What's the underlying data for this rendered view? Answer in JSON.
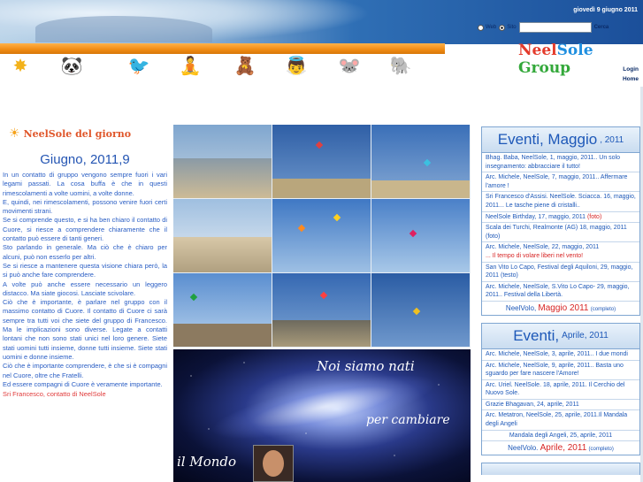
{
  "header": {
    "date": "giovedì 9 giugno 2011",
    "search": {
      "option_web": "Web",
      "option_site": "Sito",
      "selected": "Sito",
      "button_label": "Cerca",
      "placeholder": ""
    }
  },
  "brand": {
    "part1": "Neel",
    "part2": "Sole",
    "part3": " Group"
  },
  "nav": {
    "login": "Login",
    "home": "Home"
  },
  "left": {
    "section_title": "NeelSole del giorno",
    "month_title": "Giugno, 2011,9",
    "paragraphs": [
      "In un contatto di gruppo vengono sempre fuori i vari legami passati. La cosa buffa è che in questi rimescolamenti a volte uomini, a volte donne.",
      "E, quindi, nei rimescolamenti, possono venire fuori certi movimenti strani.",
      "Se si comprende questo, e si ha ben chiaro il contatto di Cuore, si riesce a comprendere chiaramente che il contatto può essere di tanti generi.",
      "Sto parlando in generale. Ma ciò che è chiaro per alcuni, può non esserlo per altri.",
      "Se si riesce a mantenere questa visione chiara però, la si può anche fare comprendere.",
      "A volte può anche essere necessario un leggero distacco. Ma siate giocosi. Lasciate scivolare.",
      "Ciò che è importante, è parlare nel gruppo con il massimo contatto di Cuore. Il contatto di Cuore ci sarà sempre tra tutti voi che siete del gruppo di Francesco. Ma le implicazioni sono diverse. Legate a contatti lontani che non sono stati unici nel loro genere. Siete stati uomini tutti insieme, donne tutti insieme. Siete stati uomini e donne insieme.",
      "Ciò che è importante comprendere, è che si è compagni nel Cuore, oltre che Fratelli.",
      "Ed essere compagni di Cuore è veramente importante."
    ],
    "signature": "Sri Francesco, contatto di NeelSole"
  },
  "banner": {
    "line1": "Noi siamo nati",
    "line2": "per cambiare",
    "line3": "il Mondo"
  },
  "events_may": {
    "title": "Eventi, Maggio",
    "year": ", 2011",
    "items": [
      "Bhag. Baba, NeelSole, 1, maggio, 2011.. Un solo insegnamento: abbracciare il tutto!",
      "Arc. Michele, NeelSole, 7, maggio, 2011.. Affermare l'amore !",
      "Sri Francesco d'Assisi. NeelSole. Sciacca. 16, maggio, 2011... Le tasche piene di cristalli..",
      "NeelSole Birthday, 17, maggio, 2011",
      "Scala dei Turchi, Realmonte (AG) 18, maggio, 2011",
      "Arc. Michele, NeelSole, 22, maggio, 2011",
      "... Il tempo di volare liberi nel vento!",
      "San Vito Lo Capo, Festival degli Aquiloni, 29, maggio, 2011",
      "Arc. Michele, NeelSole, S.Vito Lo Capo- 29, maggio, 2011.. Festival della Libertà."
    ],
    "tag_foto": "(foto)",
    "tag_foto2": "(foto)",
    "tag_testo": "(testo)",
    "footer_brand": "NeelVolo,",
    "footer_month": "Maggio 2011",
    "footer_note": "(completo)"
  },
  "events_april": {
    "title": "Eventi,",
    "month": "Aprile, 2011",
    "items": [
      "Arc. Michele, NeelSole, 3, aprile, 2011.. I due mondi",
      "Arc. Michele, NeelSole, 9, aprile, 2011.. Basta uno sguardo per fare nascere l'Amore!",
      "Arc. Uriel. NeelSole. 18, aprile, 2011. Il Cerchio del Nuovo Sole.",
      "Grazie Bhagavan, 24, aprile, 2011",
      "Arc. Metatron, NeelSole, 25, aprile, 2011.Il Mandala degli Angeli",
      "Mandala degli Angeli, 25, aprile, 2011"
    ],
    "footer_brand": "NeelVolo.",
    "footer_month": "Aprile, 2011",
    "footer_note": "(completo)"
  },
  "colors": {
    "accent_orange": "#f08a12",
    "link_blue": "#1d58b8",
    "highlight_red": "#d72525"
  },
  "icons": [
    "star-icon",
    "panda-new-icon",
    "bird-icon",
    "meditation-icon",
    "teddy-bear-icon",
    "angel-icon",
    "mouse-icon",
    "elephant-icon"
  ]
}
